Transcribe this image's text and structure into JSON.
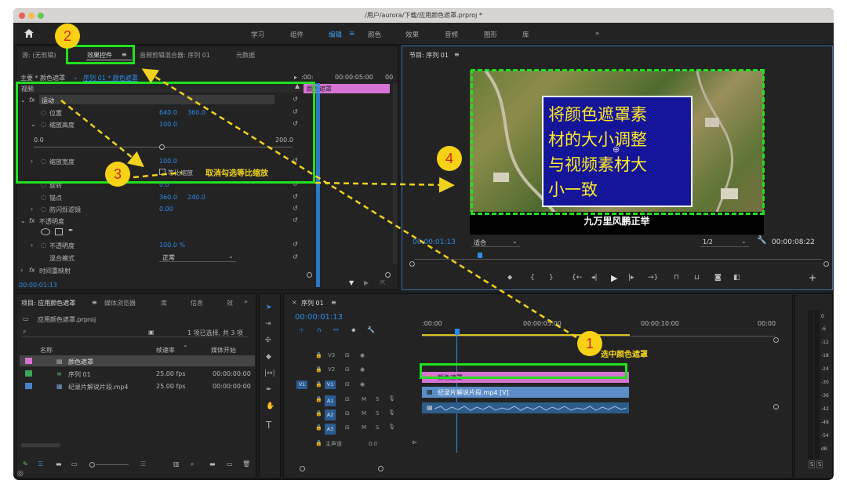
{
  "window": {
    "title": "/用户/aurora/下载/应用颜色遮罩.prproj *"
  },
  "workspaces": [
    "学习",
    "组件",
    "编辑",
    "颜色",
    "效果",
    "音频",
    "图形",
    "库",
    "»"
  ],
  "workspace_active_index": 2,
  "source_panel": {
    "tabs": [
      "源: (无剪辑)",
      "效果控件",
      "音频剪辑混合器: 序列 01",
      "元数据"
    ],
    "breadcrumb_master": "主要 * 颜色遮罩",
    "breadcrumb_seq": "序列 01 * 颜色遮罩",
    "time_start": ":00:",
    "time_mid": "00:00:05:00",
    "time_end": "00",
    "clip_label": "颜色遮罩",
    "section_video": "视频",
    "motion": "运动",
    "position_label": "位置",
    "position_x": "640.0",
    "position_y": "360.0",
    "scale_height_label": "缩放高度",
    "scale_height_value": "100.0",
    "slider_min": "0.0",
    "slider_max": "200.0",
    "scale_width_label": "缩放宽度",
    "scale_width_value": "100.0",
    "uniform_scale_label": "等比缩放",
    "rotation_label": "旋转",
    "rotation_value": "0.0",
    "anchor_label": "锚点",
    "anchor_x": "360.0",
    "anchor_y": "240.0",
    "flicker_label": "防闪烁滤镜",
    "flicker_value": "0.00",
    "opacity_section": "不透明度",
    "opacity_label": "不透明度",
    "opacity_value": "100.0 %",
    "blend_label": "混合模式",
    "blend_value": "正常",
    "time_remap": "时间重映射",
    "current_time": "00:00:01:13"
  },
  "program_monitor": {
    "title": "节目: 序列 01",
    "overlay_lines": [
      "将颜色遮罩素",
      "材的大小调整",
      "与视频素材大",
      "小一致"
    ],
    "caption": "九万里风鹏正举",
    "timecode": "00:00:01:13",
    "fit": "适合",
    "resolution": "1/2",
    "duration": "00:00:08:22"
  },
  "project_panel": {
    "tabs": [
      "项目: 应用颜色遮罩",
      "媒体浏览器",
      "库",
      "信息",
      "效"
    ],
    "file_name": "应用颜色遮罩.prproj",
    "selection_info": "1 项已选择, 共 3 项",
    "columns": [
      "名称",
      "帧速率",
      "媒体开始"
    ],
    "items": [
      {
        "name": "颜色遮罩",
        "fps": "",
        "start": "",
        "color": "#d36fd6"
      },
      {
        "name": "序列 01",
        "fps": "25.00 fps",
        "start": "00:00:00:00",
        "color": "#3ca655"
      },
      {
        "name": "纪录片解说片段.mp4",
        "fps": "25.00 fps",
        "start": "00:00:00:00",
        "color": "#4a83c7"
      }
    ]
  },
  "timeline": {
    "title": "序列 01",
    "timecode": "00:00:01:13",
    "ruler": [
      ":00:00",
      "00:00:05:00",
      "00:00:10:00",
      "00:00"
    ],
    "tracks": [
      {
        "name": "V3"
      },
      {
        "name": "V2"
      },
      {
        "name": "V1"
      },
      {
        "name": "A1"
      },
      {
        "name": "A2"
      },
      {
        "name": "A3"
      }
    ],
    "source_patch_video": "V1",
    "clip_matte": "颜色遮罩",
    "clip_video": "纪录片解说片段.mp4 [V]",
    "master_label": "主声道",
    "master_value": "0.0"
  },
  "meter": {
    "ticks": [
      "0",
      "-6",
      "-12",
      "-18",
      "-24",
      "-30",
      "-36",
      "-42",
      "-48",
      "-54",
      "dB"
    ],
    "solo": [
      "S",
      "S"
    ]
  },
  "annotations": {
    "step1": "1",
    "step1_text": "选中颜色遮罩",
    "step2": "2",
    "step3": "3",
    "step3_text": "取消勾选等比缩放",
    "step4": "4",
    "accent": "#21e01f",
    "arrow_color": "#f1d21c"
  }
}
